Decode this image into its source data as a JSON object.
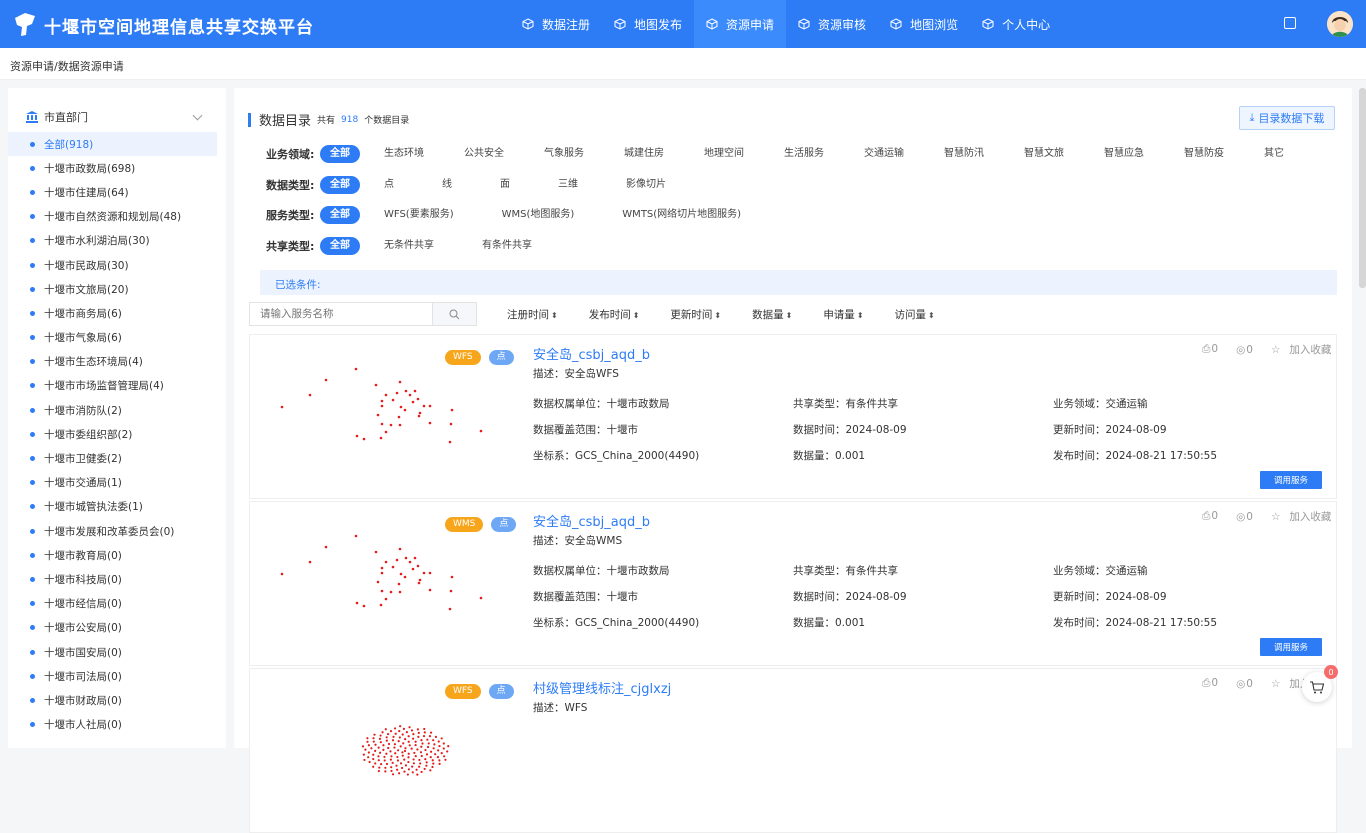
{
  "app": {
    "title": "十堰市空间地理信息共享交换平台"
  },
  "nav": [
    {
      "label": "数据注册",
      "icon": "cube-icon",
      "active": false
    },
    {
      "label": "地图发布",
      "icon": "cube-icon",
      "active": false
    },
    {
      "label": "资源申请",
      "icon": "cube-icon",
      "active": true
    },
    {
      "label": "资源审核",
      "icon": "cube-icon",
      "active": false
    },
    {
      "label": "地图浏览",
      "icon": "cube-icon",
      "active": false
    },
    {
      "label": "个人中心",
      "icon": "cube-icon",
      "active": false
    }
  ],
  "breadcrumb": "资源申请/数据资源申请",
  "sidebar": {
    "header": "市直部门",
    "items": [
      "全部(918)",
      "十堰市政数局(698)",
      "十堰市住建局(64)",
      "十堰市自然资源和规划局(48)",
      "十堰市水利湖泊局(30)",
      "十堰市民政局(30)",
      "十堰市文旅局(20)",
      "十堰市商务局(6)",
      "十堰市气象局(6)",
      "十堰市生态环境局(4)",
      "十堰市市场监督管理局(4)",
      "十堰市消防队(2)",
      "十堰市委组织部(2)",
      "十堰市卫健委(2)",
      "十堰市交通局(1)",
      "十堰市城管执法委(1)",
      "十堰市发展和改革委员会(0)",
      "十堰市教育局(0)",
      "十堰市科技局(0)",
      "十堰市经信局(0)",
      "十堰市公安局(0)",
      "十堰市国安局(0)",
      "十堰市司法局(0)",
      "十堰市财政局(0)",
      "十堰市人社局(0)"
    ]
  },
  "catalog": {
    "title": "数据目录",
    "total_prefix": "共有",
    "total": "918",
    "total_suffix": "个数据目录",
    "download_label": "目录数据下载"
  },
  "filters": [
    {
      "label": "业务领域:",
      "options": [
        "全部",
        "生态环境",
        "公共安全",
        "气象服务",
        "城建住房",
        "地理空间",
        "生活服务",
        "交通运输",
        "智慧防汛",
        "智慧文旅",
        "智慧应急",
        "智慧防疫",
        "其它"
      ]
    },
    {
      "label": "数据类型:",
      "options": [
        "全部",
        "点",
        "线",
        "面",
        "三维",
        "影像切片"
      ]
    },
    {
      "label": "服务类型:",
      "options": [
        "全部",
        "WFS(要素服务)",
        "WMS(地图服务)",
        "WMTS(网络切片地图服务)"
      ]
    },
    {
      "label": "共享类型:",
      "options": [
        "全部",
        "无条件共享",
        "有条件共享"
      ]
    }
  ],
  "selected_label": "已选条件:",
  "search": {
    "placeholder": "请输入服务名称"
  },
  "sorts": [
    "注册时间",
    "发布时间",
    "更新时间",
    "数据量",
    "申请量",
    "访问量"
  ],
  "cards": [
    {
      "name": "安全岛_csbj_aqd_b",
      "desc": "描述：安全岛WFS",
      "tags": [
        "WFS",
        "点"
      ],
      "owner": "数据权属单位：十堰市政数局",
      "share": "共享类型：有条件共享",
      "domain": "业务领域：交通运输",
      "coverage": "数据覆盖范围：十堰市",
      "data_time": "数据时间：2024-08-09",
      "update_time": "更新时间：2024-08-09",
      "crs": "坐标系：GCS_China_2000(4490)",
      "volume": "数据量：0.001",
      "publish_time": "发布时间：2024-08-21 17:50:55",
      "stat_apply": "0",
      "stat_view": "0",
      "fav_label": "加入收藏",
      "call_label": "调用服务"
    },
    {
      "name": "安全岛_csbj_aqd_b",
      "desc": "描述：安全岛WMS",
      "tags": [
        "WMS",
        "点"
      ],
      "owner": "数据权属单位：十堰市政数局",
      "share": "共享类型：有条件共享",
      "domain": "业务领域：交通运输",
      "coverage": "数据覆盖范围：十堰市",
      "data_time": "数据时间：2024-08-09",
      "update_time": "更新时间：2024-08-09",
      "crs": "坐标系：GCS_China_2000(4490)",
      "volume": "数据量：0.001",
      "publish_time": "发布时间：2024-08-21 17:50:55",
      "stat_apply": "0",
      "stat_view": "0",
      "fav_label": "加入收藏",
      "call_label": "调用服务"
    },
    {
      "name": "村级管理线标注_cjglxzj",
      "desc": "描述：WFS",
      "tags": [
        "WFS",
        "点"
      ],
      "stat_apply": "0",
      "stat_view": "0",
      "fav_label": "加入"
    }
  ],
  "cart": {
    "count": "0"
  },
  "colors": {
    "primary": "#2d7cf6",
    "tag_orange": "#f7a61b",
    "tag_blue": "#6ea8f5",
    "point": "#e51c1c"
  }
}
